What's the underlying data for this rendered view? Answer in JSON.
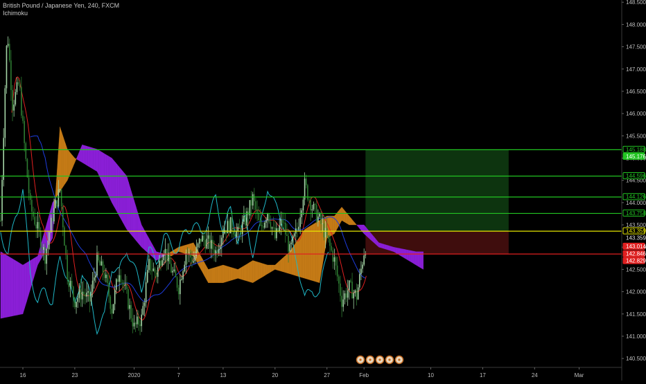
{
  "header": {
    "title": "British Pound / Japanese Yen, 240, FXCM",
    "indicator": "Ichimoku"
  },
  "chart_data": {
    "type": "candlestick",
    "symbol": "GBPJPY",
    "timeframe": "240",
    "source": "FXCM",
    "ylim": [
      140.3,
      148.55
    ],
    "y_ticks": [
      "140.500",
      "141.000",
      "141.500",
      "142.000",
      "142.500",
      "143.000",
      "143.500",
      "144.000",
      "144.500",
      "145.000",
      "145.500",
      "146.000",
      "146.500",
      "147.000",
      "147.500",
      "148.000",
      "148.500"
    ],
    "x_ticks": [
      {
        "label": "16",
        "day": 0
      },
      {
        "label": "23",
        "day": 7
      },
      {
        "label": "2020",
        "day": 15
      },
      {
        "label": "7",
        "day": 21
      },
      {
        "label": "13",
        "day": 27
      },
      {
        "label": "20",
        "day": 34
      },
      {
        "label": "27",
        "day": 41
      },
      {
        "label": "Feb",
        "day": 46
      },
      {
        "label": "10",
        "day": 55
      },
      {
        "label": "17",
        "day": 62
      },
      {
        "label": "24",
        "day": 69
      },
      {
        "label": "Mar",
        "day": 75
      }
    ],
    "price_levels": [
      {
        "label": "145.188",
        "price": 145.188,
        "color": "#22c422",
        "style": "outline"
      },
      {
        "label": "145.176",
        "price": 145.176,
        "color": "#22c422",
        "style": "filled"
      },
      {
        "label": "144.596",
        "price": 144.596,
        "color": "#22c422",
        "style": "outline"
      },
      {
        "label": "144.126",
        "price": 144.126,
        "color": "#22c422",
        "style": "outline"
      },
      {
        "label": "143.758",
        "price": 143.758,
        "color": "#22c422",
        "style": "outline"
      },
      {
        "label": "143.359",
        "price": 143.359,
        "color": "#e8e800",
        "style": "outline"
      },
      {
        "label": "143.359",
        "price": 143.359,
        "color": "#e8e800",
        "style": "plain"
      },
      {
        "label": "143.014",
        "price": 143.014,
        "color": "#e02020",
        "style": "filled"
      },
      {
        "label": "142.846",
        "price": 142.846,
        "color": "#e02020",
        "style": "filled"
      },
      {
        "label": "142.829",
        "price": 142.829,
        "color": "#e02020",
        "style": "filled"
      }
    ],
    "lines": [
      {
        "price": 145.188,
        "color": "#22c422"
      },
      {
        "price": 144.596,
        "color": "#22c422"
      },
      {
        "price": 144.126,
        "color": "#22c422"
      },
      {
        "price": 143.758,
        "color": "#22c422"
      },
      {
        "price": 143.359,
        "color": "#e8e800"
      },
      {
        "price": 142.846,
        "color": "#e02020"
      }
    ],
    "position": {
      "type": "long",
      "entry": 143.359,
      "target": 145.188,
      "stop": 142.846,
      "start_day": 46.2,
      "end_day": 65.5
    },
    "cloud_bull_color": "#c47a16",
    "cloud_bear_color": "#8a1fd6",
    "candle_up_color": "#a5d6a7",
    "candle_down_color": "#2e7d32",
    "tenkan_color": "#e02020",
    "kijun_color": "#1e3de0",
    "chikou_color": "#1fb8c8",
    "event_markers": 5
  }
}
